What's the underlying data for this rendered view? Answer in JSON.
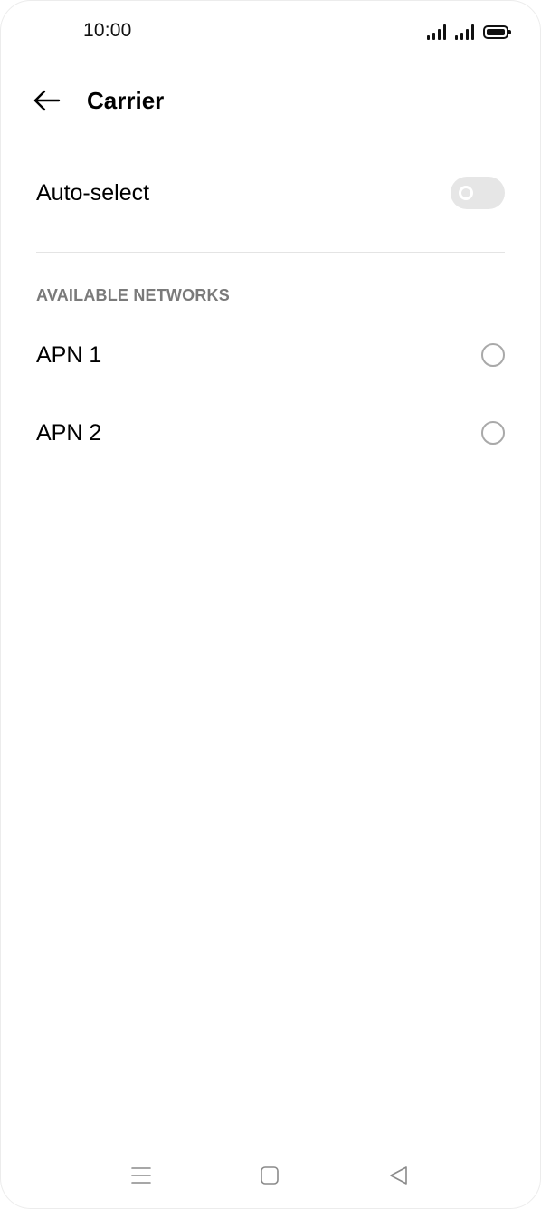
{
  "status_bar": {
    "time": "10:00",
    "icons": [
      "signal-icon",
      "signal-icon",
      "battery-icon"
    ]
  },
  "header": {
    "back_icon": "arrow-left-icon",
    "title": "Carrier"
  },
  "auto_select": {
    "label": "Auto-select",
    "enabled": false
  },
  "networks": {
    "section_label": "AVAILABLE NETWORKS",
    "items": [
      {
        "label": "APN 1",
        "selected": false
      },
      {
        "label": "APN 2",
        "selected": false
      }
    ]
  },
  "nav_bar": {
    "icons": [
      "menu-icon",
      "home-icon",
      "back-icon"
    ]
  },
  "colors": {
    "text": "#000000",
    "section_label": "#7a7a7a",
    "toggle_off": "#e6e6e6",
    "radio_border": "#a9a9a9",
    "divider": "#e4e4e4",
    "nav_icon": "#8a8a8a"
  }
}
